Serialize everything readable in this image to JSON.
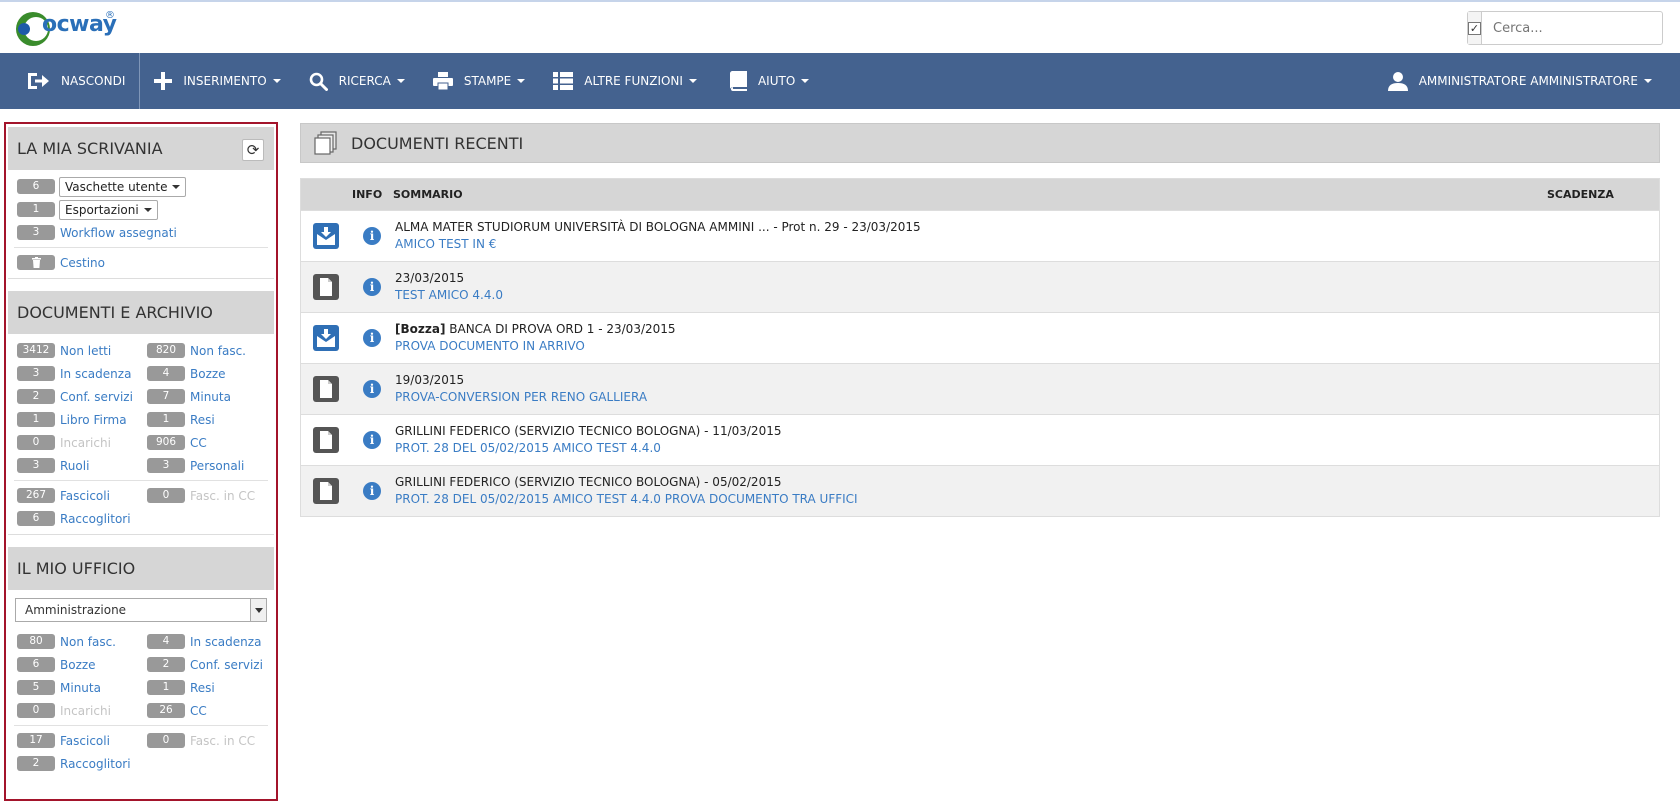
{
  "header": {
    "logo_text": "ocway",
    "logo_reg": "®",
    "search_placeholder": "Cerca..."
  },
  "nav": {
    "nascondi": "NASCONDI",
    "inserimento": "INSERIMENTO",
    "ricerca": "RICERCA",
    "stampe": "STAMPE",
    "altre_funzioni": "ALTRE FUNZIONI",
    "aiuto": "AIUTO",
    "user": "AMMINISTRATORE AMMINISTRATORE"
  },
  "scrivania": {
    "title": "LA MIA SCRIVANIA",
    "vaschette_count": "6",
    "vaschette_label": "Vaschette utente",
    "esportazioni_count": "1",
    "esportazioni_label": "Esportazioni",
    "workflow_count": "3",
    "workflow_label": "Workflow assegnati",
    "cestino_label": "Cestino"
  },
  "archivio": {
    "title": "DOCUMENTI E ARCHIVIO",
    "items": [
      {
        "count": "3412",
        "label": "Non letti"
      },
      {
        "count": "820",
        "label": "Non fasc."
      },
      {
        "count": "3",
        "label": "In scadenza"
      },
      {
        "count": "4",
        "label": "Bozze"
      },
      {
        "count": "2",
        "label": "Conf. servizi"
      },
      {
        "count": "7",
        "label": "Minuta"
      },
      {
        "count": "1",
        "label": "Libro Firma"
      },
      {
        "count": "1",
        "label": "Resi"
      },
      {
        "count": "0",
        "label": "Incarichi"
      },
      {
        "count": "906",
        "label": "CC"
      },
      {
        "count": "3",
        "label": "Ruoli"
      },
      {
        "count": "3",
        "label": "Personali"
      }
    ],
    "fascicoli_count": "267",
    "fascicoli_label": "Fascicoli",
    "fasc_cc_count": "0",
    "fasc_cc_label": "Fasc. in CC",
    "raccoglitori_count": "6",
    "raccoglitori_label": "Raccoglitori"
  },
  "ufficio": {
    "title": "IL MIO UFFICIO",
    "selected": "Amministrazione",
    "items": [
      {
        "count": "80",
        "label": "Non fasc."
      },
      {
        "count": "4",
        "label": "In scadenza"
      },
      {
        "count": "6",
        "label": "Bozze"
      },
      {
        "count": "2",
        "label": "Conf. servizi"
      },
      {
        "count": "5",
        "label": "Minuta"
      },
      {
        "count": "1",
        "label": "Resi"
      },
      {
        "count": "0",
        "label": "Incarichi"
      },
      {
        "count": "26",
        "label": "CC"
      }
    ],
    "fascicoli_count": "17",
    "fascicoli_label": "Fascicoli",
    "fasc_cc_count": "0",
    "fasc_cc_label": "Fasc. in CC",
    "raccoglitori_count": "2",
    "raccoglitori_label": "Raccoglitori"
  },
  "recenti": {
    "title": "DOCUMENTI RECENTI",
    "col_info": "INFO",
    "col_sommario": "SOMMARIO",
    "col_scadenza": "SCADENZA",
    "rows": [
      {
        "type": "arrivo",
        "prefix": "",
        "line1": "ALMA MATER STUDIORUM UNIVERSITÀ DI BOLOGNA AMMINI ... - Prot n. 29 - 23/03/2015",
        "line2": "AMICO TEST IN €"
      },
      {
        "type": "doc",
        "prefix": "",
        "line1": "23/03/2015",
        "line2": "TEST AMICO 4.4.0"
      },
      {
        "type": "arrivo",
        "prefix": "[Bozza]",
        "line1": " BANCA DI PROVA ORD 1 - 23/03/2015",
        "line2": "PROVA DOCUMENTO IN ARRIVO"
      },
      {
        "type": "doc",
        "prefix": "",
        "line1": "19/03/2015",
        "line2": "PROVA-CONVERSION PER RENO GALLIERA"
      },
      {
        "type": "doc",
        "prefix": "",
        "line1": "GRILLINI FEDERICO (SERVIZIO TECNICO BOLOGNA) - 11/03/2015",
        "line2": "PROT. 28 DEL 05/02/2015 AMICO TEST 4.4.0"
      },
      {
        "type": "doc",
        "prefix": "",
        "line1": "GRILLINI FEDERICO (SERVIZIO TECNICO BOLOGNA) - 05/02/2015",
        "line2": "PROT. 28 DEL 05/02/2015 AMICO TEST 4.4.0 PROVA DOCUMENTO TRA UFFICI"
      }
    ]
  },
  "colors": {
    "navbar": "#44628f",
    "link": "#3a7cc4",
    "sidebar_border": "#a3142b",
    "badge": "#999999"
  }
}
